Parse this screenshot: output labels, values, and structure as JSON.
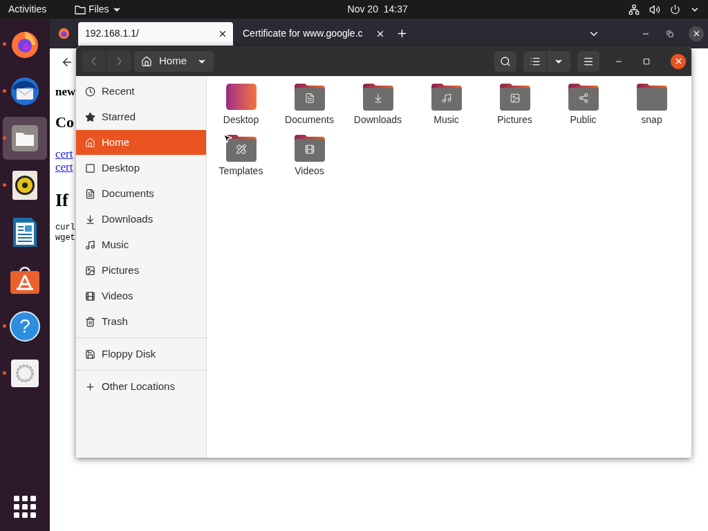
{
  "top_bar": {
    "activities": "Activities",
    "app_menu": "Files",
    "clock": "Nov 20  14:37"
  },
  "dock": {
    "items": [
      {
        "kind": "firefox",
        "running": true,
        "selected": false
      },
      {
        "kind": "thunderbird",
        "running": true,
        "selected": false
      },
      {
        "kind": "files",
        "running": true,
        "selected": true
      },
      {
        "kind": "rhythmbox",
        "running": true,
        "selected": false
      },
      {
        "kind": "writer",
        "running": false,
        "selected": false
      },
      {
        "kind": "software",
        "running": false,
        "selected": false
      },
      {
        "kind": "help",
        "running": true,
        "selected": false,
        "glyph": "?"
      },
      {
        "kind": "settings",
        "running": true,
        "selected": false
      }
    ]
  },
  "browser": {
    "tabs": [
      {
        "title": "192.168.1.1/",
        "selected": true
      },
      {
        "title": "Certificate for www.google.c",
        "selected": false
      }
    ],
    "page": [
      {
        "kind": "bold",
        "text": "new"
      },
      {
        "kind": "heading",
        "text": "Co"
      },
      {
        "kind": "link",
        "text": "cert"
      },
      {
        "kind": "link",
        "text": "cert"
      },
      {
        "kind": "big",
        "text": "If"
      },
      {
        "kind": "code",
        "text": "curl"
      },
      {
        "kind": "code",
        "text": "wget"
      }
    ]
  },
  "files": {
    "location": "Home",
    "sidebar": [
      [
        {
          "label": "Recent",
          "kind": "recent",
          "selected": false
        },
        {
          "label": "Starred",
          "kind": "star",
          "selected": false
        },
        {
          "label": "Home",
          "kind": "home",
          "selected": true
        },
        {
          "label": "Desktop",
          "kind": "desktop",
          "selected": false
        },
        {
          "label": "Documents",
          "kind": "documents",
          "selected": false
        },
        {
          "label": "Downloads",
          "kind": "downloads",
          "selected": false
        },
        {
          "label": "Music",
          "kind": "music",
          "selected": false
        },
        {
          "label": "Pictures",
          "kind": "pictures",
          "selected": false
        },
        {
          "label": "Videos",
          "kind": "videos",
          "selected": false
        },
        {
          "label": "Trash",
          "kind": "trash",
          "selected": false
        }
      ],
      [
        {
          "label": "Floppy Disk",
          "kind": "floppy",
          "selected": false
        }
      ],
      [
        {
          "label": "Other Locations",
          "kind": "plus",
          "selected": false
        }
      ]
    ],
    "folders": [
      {
        "name": "Desktop",
        "kind": "desktop"
      },
      {
        "name": "Documents",
        "kind": "documents"
      },
      {
        "name": "Downloads",
        "kind": "downloads"
      },
      {
        "name": "Music",
        "kind": "music"
      },
      {
        "name": "Pictures",
        "kind": "pictures"
      },
      {
        "name": "Public",
        "kind": "public"
      },
      {
        "name": "snap",
        "kind": "plain"
      },
      {
        "name": "Templates",
        "kind": "templates"
      },
      {
        "name": "Videos",
        "kind": "videos"
      }
    ]
  }
}
